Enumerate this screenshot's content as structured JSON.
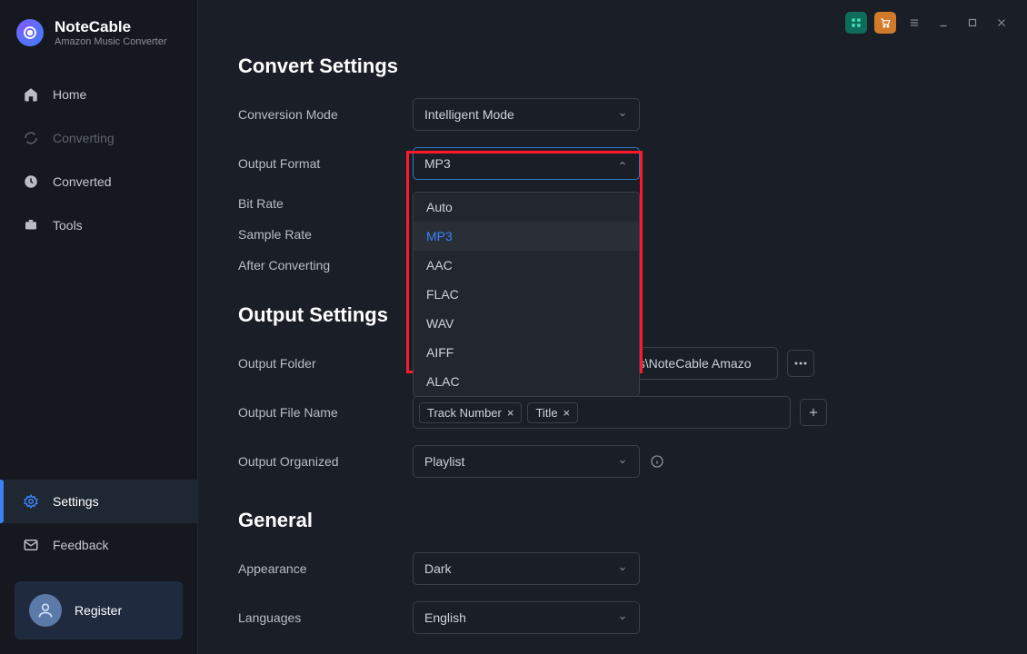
{
  "brand": {
    "title": "NoteCable",
    "subtitle": "Amazon Music Converter"
  },
  "sidebar": {
    "items": [
      {
        "label": "Home"
      },
      {
        "label": "Converting"
      },
      {
        "label": "Converted"
      },
      {
        "label": "Tools"
      },
      {
        "label": "Settings"
      },
      {
        "label": "Feedback"
      }
    ],
    "register": "Register"
  },
  "sections": {
    "convert": {
      "title": "Convert Settings",
      "conversion_mode_label": "Conversion Mode",
      "conversion_mode_value": "Intelligent Mode",
      "output_format_label": "Output Format",
      "output_format_value": "MP3",
      "output_format_options": [
        "Auto",
        "MP3",
        "AAC",
        "FLAC",
        "WAV",
        "AIFF",
        "ALAC"
      ],
      "bit_rate_label": "Bit Rate",
      "sample_rate_label": "Sample Rate",
      "after_converting_label": "After Converting"
    },
    "output": {
      "title": "Output Settings",
      "folder_label": "Output Folder",
      "folder_value": "C:\\Users\\Anvsoft\\OneDrive\\Documents\\NoteCable Amazo",
      "filename_label": "Output File Name",
      "filename_tags": [
        "Track Number",
        "Title"
      ],
      "organized_label": "Output Organized",
      "organized_value": "Playlist"
    },
    "general": {
      "title": "General",
      "appearance_label": "Appearance",
      "appearance_value": "Dark",
      "languages_label": "Languages",
      "languages_value": "English"
    }
  }
}
